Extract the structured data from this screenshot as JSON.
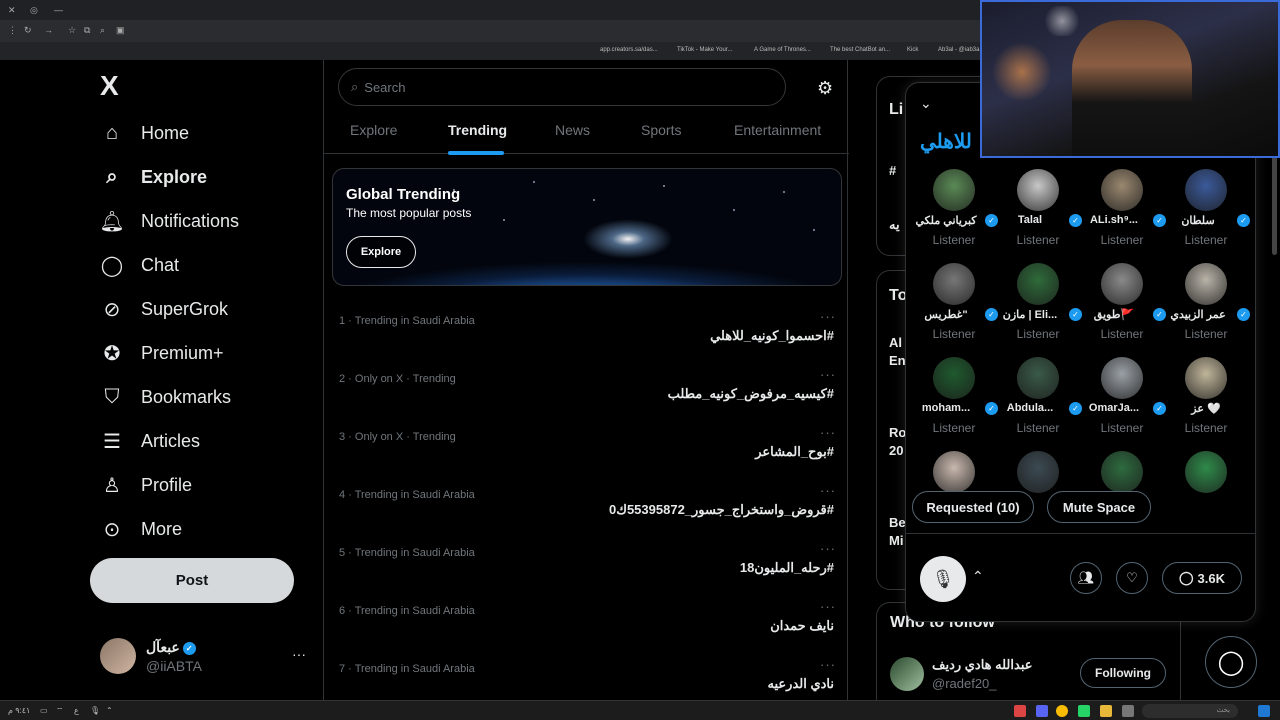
{
  "browser": {
    "bookmarks": [
      "app.creators.sa/das...",
      "TikTok - Make Your...",
      "A Game of Thrones...",
      "The best ChatBot an...",
      "Kick",
      "Ab3al - @iab3a"
    ]
  },
  "sidebar": {
    "logo": "X",
    "items": [
      {
        "label": "Home",
        "icon": "home-icon"
      },
      {
        "label": "Explore",
        "icon": "search-icon"
      },
      {
        "label": "Notifications",
        "icon": "bell-icon"
      },
      {
        "label": "Chat",
        "icon": "chat-bubble-icon"
      },
      {
        "label": "SuperGrok",
        "icon": "grok-icon"
      },
      {
        "label": "Premium+",
        "icon": "premium-check-icon"
      },
      {
        "label": "Bookmarks",
        "icon": "bookmark-icon"
      },
      {
        "label": "Articles",
        "icon": "article-icon"
      },
      {
        "label": "Profile",
        "icon": "person-icon"
      },
      {
        "label": "More",
        "icon": "more-circle-icon"
      }
    ],
    "post_label": "Post",
    "user": {
      "name": "عبعآل",
      "handle": "@iiABTA",
      "more": "···"
    }
  },
  "main": {
    "search_placeholder": "Search",
    "tabs": [
      "Explore",
      "Trending",
      "News",
      "Sports",
      "Entertainment"
    ],
    "active_tab": "Trending",
    "banner": {
      "title": "Global Trending",
      "subtitle": "The most popular posts",
      "button": "Explore"
    },
    "trends": [
      {
        "meta": "1 · Trending in Saudi Arabia",
        "title": "#احسموا_كونيه_للاهلي"
      },
      {
        "meta": "2 · Only on X · Trending",
        "title": "#كيسيه_مرفوض_كونيه_مطلب"
      },
      {
        "meta": "3 · Only on X · Trending",
        "title": "#بوح_المشاعر"
      },
      {
        "meta": "4 · Trending in Saudi Arabia",
        "title": "#قروض_واستخراج_جسور_55395872ك0"
      },
      {
        "meta": "5 · Trending in Saudi Arabia",
        "title": "#رحله_المليون18"
      },
      {
        "meta": "6 · Trending in Saudi Arabia",
        "title": "نايف حمدان"
      },
      {
        "meta": "7 · Trending in Saudi Arabia",
        "title": "نادي الدرعيه"
      }
    ]
  },
  "right": {
    "fragments": [
      "Li",
      "#",
      "يه",
      "To",
      "Al",
      "En",
      "Ro",
      "20",
      "Be",
      "Mi"
    ],
    "who_to_follow": "Who to follow",
    "follow_user": {
      "name": "عبدالله هادي رديف",
      "handle": "@radef20_",
      "button": "Following"
    }
  },
  "space": {
    "title": "للاهلي",
    "listeners": [
      {
        "name": "كبرياني ملكي",
        "role": "Listener",
        "verified": true,
        "color": "#5a8a55"
      },
      {
        "name": "Talal",
        "role": "Listener",
        "verified": true,
        "color": "#c8c8c8"
      },
      {
        "name": "ALi.sh⁹...",
        "role": "Listener",
        "verified": true,
        "color": "#9a8870"
      },
      {
        "name": "سلطان",
        "role": "Listener",
        "verified": true,
        "color": "#3b5a9a"
      },
      {
        "name": "غطريس\"",
        "role": "Listener",
        "verified": true,
        "color": "#777777"
      },
      {
        "name": "مازن | Eli...",
        "role": "Listener",
        "verified": true,
        "color": "#2f6b3a"
      },
      {
        "name": "طويق🚩",
        "role": "Listener",
        "verified": true,
        "color": "#8a8a8a"
      },
      {
        "name": "عمر الزبيدي",
        "role": "Listener",
        "verified": true,
        "color": "#b9b3a8"
      },
      {
        "name": "moham...",
        "role": "Listener",
        "verified": true,
        "color": "#1f5a2e"
      },
      {
        "name": "Abdula...",
        "role": "Listener",
        "verified": true,
        "color": "#3a5a48"
      },
      {
        "name": "OmarJa...",
        "role": "Listener",
        "verified": true,
        "color": "#9aa0a6"
      },
      {
        "name": "عز 🤍",
        "role": "Listener",
        "verified": false,
        "color": "#c0b59a"
      },
      {
        "name": "",
        "role": "",
        "verified": false,
        "color": "#c9b8ae"
      },
      {
        "name": "",
        "role": "",
        "verified": false,
        "color": "#3c4a52"
      },
      {
        "name": "",
        "role": "",
        "verified": false,
        "color": "#2e6b3f"
      },
      {
        "name": "",
        "role": "",
        "verified": false,
        "color": "#2f8a4a"
      }
    ],
    "requested_label": "Requested (10)",
    "mute_label": "Mute Space",
    "reply_count": "3.6K"
  },
  "taskbar": {
    "time": "٩:٤١ م",
    "date": "٢٠٢٥/١١/١٨",
    "search": "بحث"
  },
  "colors": {
    "accent": "#1d9bf0",
    "background": "#000000",
    "text": "#e7e9ea",
    "muted": "#71767b",
    "border": "#2f3336"
  }
}
